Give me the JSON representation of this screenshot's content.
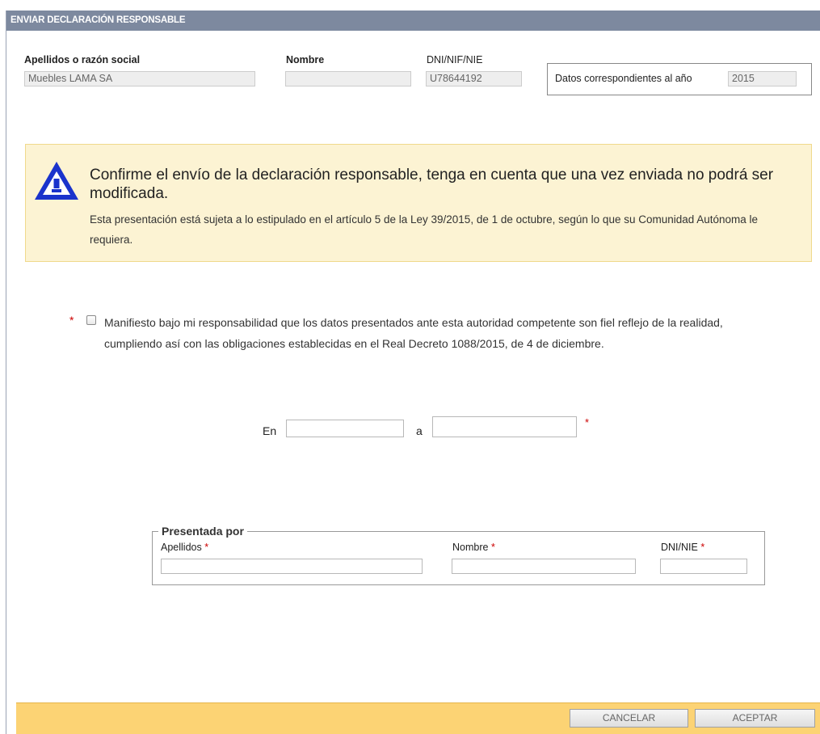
{
  "header": {
    "title": "ENVIAR DECLARACIÓN RESPONSABLE"
  },
  "identity": {
    "apellidos_label": "Apellidos o razón social",
    "apellidos_value": "Muebles LAMA SA",
    "nombre_label": "Nombre",
    "nombre_value": "",
    "dni_label": "DNI/NIF/NIE",
    "dni_value": "U78644192",
    "year_label": "Datos correspondientes al año",
    "year_value": "2015"
  },
  "warning": {
    "icon": "warning-triangle-icon",
    "title": "Confirme el envío de la declaración responsable, tenga en cuenta que una vez enviada no podrá ser modificada.",
    "body": "Esta presentación está sujeta a lo estipulado en el artículo 5 de la Ley 39/2015, de 1 de octubre, según lo que su Comunidad Autónoma le requiera."
  },
  "declaration": {
    "required_mark": "*",
    "checked": false,
    "text": "Manifiesto bajo mi responsabilidad que los datos presentados ante esta autoridad competente son fiel reflejo de la realidad, cumpliendo así con las obligaciones establecidas en el Real Decreto 1088/2015, de 4 de diciembre."
  },
  "place_date": {
    "en_label": "En",
    "en_value": "",
    "a_label": "a",
    "a_value": "",
    "required_mark": "*"
  },
  "presented_by": {
    "legend": "Presentada por",
    "apellidos_label": "Apellidos",
    "apellidos_value": "",
    "nombre_label": "Nombre",
    "nombre_value": "",
    "dni_label": "DNI/NIE",
    "dni_value": "",
    "required_mark": "*"
  },
  "footer": {
    "cancel_label": "CANCELAR",
    "accept_label": "ACEPTAR"
  },
  "colors": {
    "header_bg": "#7d899f",
    "warning_bg": "#fcf3d3",
    "warning_icon": "#1a33cc",
    "footer_bg": "#fcd374",
    "required": "#cc0000"
  }
}
